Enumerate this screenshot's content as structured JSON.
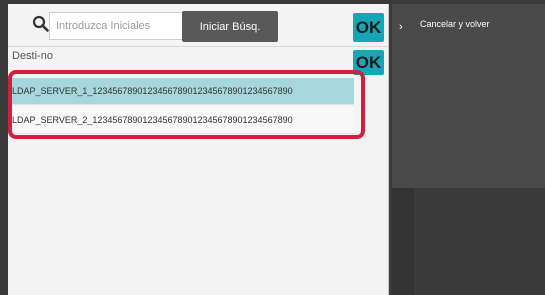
{
  "search": {
    "placeholder": "Introduzca Iniciales",
    "start_button": "Iniciar Búsq.",
    "ok_label": "OK"
  },
  "destination": {
    "label": "Desti-no",
    "ok_label": "OK",
    "items": [
      {
        "label": "LDAP_SERVER_1_1234567890123456789012345678901234567890",
        "selected": true
      },
      {
        "label": "LDAP_SERVER_2_1234567890123456789012345678901234567890",
        "selected": false
      }
    ]
  },
  "side": {
    "cancel_label": "Cancelar y volver",
    "chevron": "›"
  },
  "colors": {
    "ok_button": "#15a6b8",
    "selected_row": "#a5d7dc",
    "highlight": "#d1203f",
    "start_button": "#595959"
  }
}
